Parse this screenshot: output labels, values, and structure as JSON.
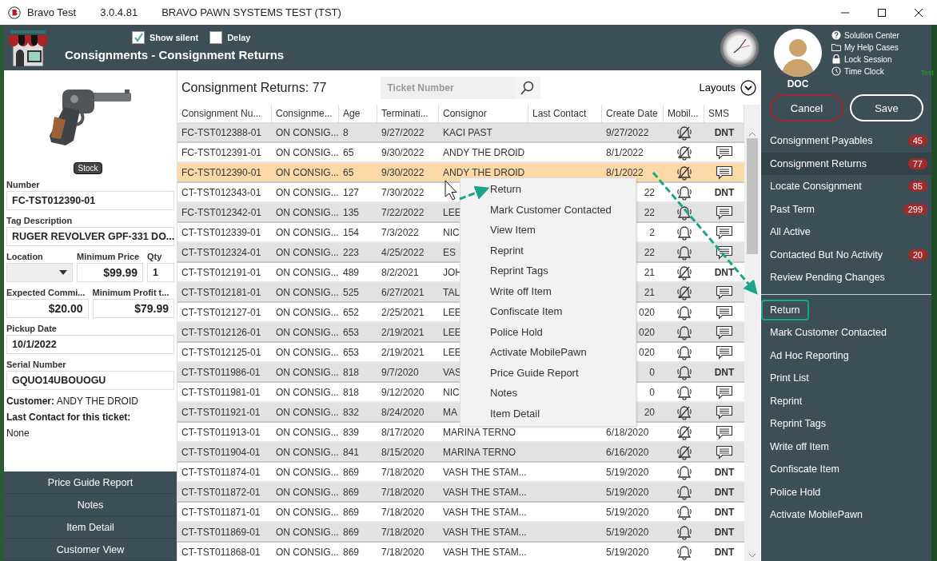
{
  "window": {
    "app": "Bravo Test",
    "version": "3.0.4.81",
    "title": "BRAVO PAWN SYSTEMS TEST (TST)"
  },
  "header": {
    "options": [
      {
        "label": "Show silent",
        "checked": true
      },
      {
        "label": "Delay",
        "checked": false
      }
    ],
    "title": "Consignments - Consignment Returns"
  },
  "item_panel": {
    "stock_badge": "Stock",
    "field_rows": [
      [
        {
          "label": "Number",
          "value": "FC-TST012390-01",
          "kind": "text"
        }
      ],
      [
        {
          "label": "Tag Description",
          "value": "RUGER REVOLVER GPF-331 DO...",
          "kind": "text"
        }
      ],
      [
        {
          "label": "Location",
          "kind": "dropdown"
        },
        {
          "label": "Minimum Price",
          "value": "$99.99",
          "kind": "money"
        },
        {
          "label": "Qty",
          "value": "1",
          "kind": "text"
        }
      ],
      [
        {
          "label": "Expected Commi...",
          "value": "$20.00",
          "kind": "money"
        },
        {
          "label": "Minimum Profit t...",
          "value": "$79.99",
          "kind": "money"
        }
      ],
      [
        {
          "label": "Pickup Date",
          "value": "10/1/2022",
          "kind": "text"
        }
      ],
      [
        {
          "label": "Serial Number",
          "value": "GQUO14UBOUOGU",
          "kind": "text"
        }
      ]
    ],
    "customer_label": "Customer:",
    "customer": "ANDY THE DROID",
    "last_contact_label": "Last Contact for this ticket:",
    "last_contact": "None",
    "buttons": [
      "Price Guide Report",
      "Notes",
      "Item Detail",
      "Customer View"
    ]
  },
  "table": {
    "heading": "Consignment Returns: 77",
    "search": {
      "placeholder": "Ticket Number"
    },
    "layouts": "Layouts",
    "columns": [
      "Consignment Nu...",
      "Consignme...",
      "Age",
      "Terminati...",
      "Consignor",
      "Last Contact",
      "Create Date",
      "Mobil...",
      "SMS"
    ],
    "rows": [
      {
        "number": "FC-TST012388-01",
        "status": "ON CONSIG...",
        "age": "8",
        "termination": "9/27/2022",
        "consignor": "KACI PAST",
        "create_date": "9/27/2022",
        "mobile_muted": true,
        "sms_blocked": true,
        "sms": "DNT",
        "selected": false
      },
      {
        "number": "FC-TST012391-01",
        "status": "ON CONSIG...",
        "age": "65",
        "termination": "9/30/2022",
        "consignor": "ANDY THE DROID",
        "create_date": "8/1/2022",
        "mobile_muted": true,
        "sms_blocked": false,
        "selected": false
      },
      {
        "number": "FC-TST012390-01",
        "status": "ON CONSIG...",
        "age": "65",
        "termination": "9/30/2022",
        "consignor": "ANDY THE DROID",
        "create_date": "8/1/2022",
        "mobile_muted": true,
        "sms_blocked": false,
        "selected": true
      },
      {
        "number": "CT-TST012343-01",
        "status": "ON CONSIG...",
        "age": "127",
        "termination": "7/30/2022",
        "create_date": "22",
        "date_cut": true,
        "mobile_muted": false,
        "sms_blocked": true,
        "sms": "DNT",
        "selected": false
      },
      {
        "number": "FC-TST012342-01",
        "status": "ON CONSIG...",
        "age": "135",
        "termination": "7/22/2022",
        "consignor": "LEE",
        "create_date": "22",
        "date_cut": true,
        "mobile_muted": false,
        "sms_blocked": false,
        "selected": false
      },
      {
        "number": "CT-TST012339-01",
        "status": "ON CONSIG...",
        "age": "154",
        "termination": "7/3/2022",
        "consignor": "NIC",
        "create_date": "2",
        "date_cut": true,
        "mobile_muted": false,
        "sms_blocked": false,
        "selected": false
      },
      {
        "number": "CT-TST012324-01",
        "status": "ON CONSIG...",
        "age": "223",
        "termination": "4/25/2022",
        "consignor": "ES",
        "create_date": "22",
        "date_cut": true,
        "mobile_muted": false,
        "sms_blocked": false,
        "selected": false
      },
      {
        "number": "CT-TST012191-01",
        "status": "ON CONSIG...",
        "age": "489",
        "termination": "8/2/2021",
        "consignor": "JOH",
        "create_date": "21",
        "date_cut": true,
        "mobile_muted": true,
        "sms_blocked": true,
        "sms": "DNT",
        "selected": false
      },
      {
        "number": "CT-TST012181-01",
        "status": "ON CONSIG...",
        "age": "525",
        "termination": "6/27/2021",
        "consignor": "TAL",
        "create_date": "21",
        "date_cut": true,
        "mobile_muted": true,
        "sms_blocked": false,
        "selected": false
      },
      {
        "number": "CT-TST012127-01",
        "status": "ON CONSIG...",
        "age": "652",
        "termination": "2/25/2021",
        "consignor": "LEE",
        "create_date": "020",
        "date_cut": true,
        "mobile_muted": false,
        "sms_blocked": false,
        "selected": false
      },
      {
        "number": "CT-TST012126-01",
        "status": "ON CONSIG...",
        "age": "653",
        "termination": "2/19/2021",
        "consignor": "LEE",
        "create_date": "020",
        "date_cut": true,
        "mobile_muted": false,
        "sms_blocked": false,
        "selected": false
      },
      {
        "number": "CT-TST012125-01",
        "status": "ON CONSIG...",
        "age": "653",
        "termination": "2/19/2021",
        "consignor": "LEE",
        "create_date": "020",
        "date_cut": true,
        "mobile_muted": false,
        "sms_blocked": false,
        "selected": false
      },
      {
        "number": "CT-TST011986-01",
        "status": "ON CONSIG...",
        "age": "818",
        "termination": "9/7/2020",
        "consignor": "VAS",
        "create_date": "0",
        "date_cut": true,
        "mobile_muted": false,
        "sms_blocked": true,
        "sms": "DNT",
        "selected": false
      },
      {
        "number": "CT-TST011981-01",
        "status": "ON CONSIG...",
        "age": "818",
        "termination": "9/12/2020",
        "consignor": "NIC",
        "create_date": "0",
        "date_cut": true,
        "mobile_muted": false,
        "sms_blocked": false,
        "selected": false
      },
      {
        "number": "CT-TST011921-01",
        "status": "ON CONSIG...",
        "age": "832",
        "termination": "8/24/2020",
        "consignor": "MA",
        "create_date": "20",
        "date_cut": true,
        "mobile_muted": true,
        "sms_blocked": false,
        "selected": false
      },
      {
        "number": "CT-TST011913-01",
        "status": "ON CONSIG...",
        "age": "839",
        "termination": "8/17/2020",
        "consignor": "MARINA TERNO",
        "create_date": "6/18/2020",
        "mobile_muted": true,
        "sms_blocked": false,
        "selected": false
      },
      {
        "number": "CT-TST011904-01",
        "status": "ON CONSIG...",
        "age": "841",
        "termination": "8/15/2020",
        "consignor": "MARINA TERNO",
        "create_date": "6/16/2020",
        "mobile_muted": true,
        "sms_blocked": false,
        "selected": false
      },
      {
        "number": "CT-TST011874-01",
        "status": "ON CONSIG...",
        "age": "869",
        "termination": "7/18/2020",
        "consignor": "VASH THE STAM...",
        "create_date": "5/19/2020",
        "mobile_muted": false,
        "sms_blocked": true,
        "sms": "DNT",
        "selected": false
      },
      {
        "number": "CT-TST011872-01",
        "status": "ON CONSIG...",
        "age": "869",
        "termination": "7/18/2020",
        "consignor": "VASH THE STAM...",
        "create_date": "5/19/2020",
        "mobile_muted": false,
        "sms_blocked": true,
        "sms": "DNT",
        "selected": false
      },
      {
        "number": "CT-TST011871-01",
        "status": "ON CONSIG...",
        "age": "869",
        "termination": "7/18/2020",
        "consignor": "VASH THE STAM...",
        "create_date": "5/19/2020",
        "mobile_muted": false,
        "sms_blocked": true,
        "sms": "DNT",
        "selected": false
      },
      {
        "number": "CT-TST011869-01",
        "status": "ON CONSIG...",
        "age": "869",
        "termination": "7/18/2020",
        "consignor": "VASH THE STAM...",
        "create_date": "5/19/2020",
        "mobile_muted": false,
        "sms_blocked": true,
        "sms": "DNT",
        "selected": false
      },
      {
        "number": "CT-TST011868-01",
        "status": "ON CONSIG...",
        "age": "869",
        "termination": "7/18/2020",
        "consignor": "VASH THE STAM...",
        "create_date": "5/19/2020",
        "mobile_muted": false,
        "sms_blocked": true,
        "sms": "DNT",
        "selected": false
      }
    ]
  },
  "context_menu": {
    "items": [
      "Return",
      "Mark Customer Contacted",
      "View Item",
      "Reprint",
      "Reprint Tags",
      "Write off Item",
      "Confiscate Item",
      "Police Hold",
      "Activate MobilePawn",
      "Price Guide Report",
      "Notes",
      "Item Detail"
    ]
  },
  "sidebar": {
    "user": "DOC",
    "links": [
      "Solution Center",
      "My Help Cases",
      "Lock Session",
      "Time Clock"
    ],
    "corner_text": "Test",
    "cancel": "Cancel",
    "save": "Save",
    "nav": [
      {
        "label": "Consignment Payables",
        "badge": "45",
        "selected": false
      },
      {
        "label": "Consignment Returns",
        "badge": "77",
        "selected": true
      },
      {
        "label": "Locate Consignment",
        "badge": "85",
        "selected": false
      },
      {
        "label": "Past Term",
        "badge": "299",
        "selected": false
      },
      {
        "label": "All Active",
        "selected": false
      },
      {
        "label": "Contacted But No Activity",
        "badge": "20",
        "selected": false
      },
      {
        "label": "Review Pending Changes",
        "selected": false
      }
    ],
    "actions": [
      {
        "label": "Return",
        "highlighted": true
      },
      {
        "label": "Mark Customer Contacted",
        "highlighted": false
      },
      {
        "label": "Ad Hoc Reporting",
        "highlighted": false
      },
      {
        "label": "Print List",
        "highlighted": false
      },
      {
        "label": "Reprint",
        "highlighted": false
      },
      {
        "label": "Reprint Tags",
        "highlighted": false
      },
      {
        "label": "Write off Item",
        "highlighted": false
      },
      {
        "label": "Confiscate Item",
        "highlighted": false
      },
      {
        "label": "Police Hold",
        "highlighted": false
      },
      {
        "label": "Activate MobilePawn",
        "highlighted": false
      }
    ]
  }
}
